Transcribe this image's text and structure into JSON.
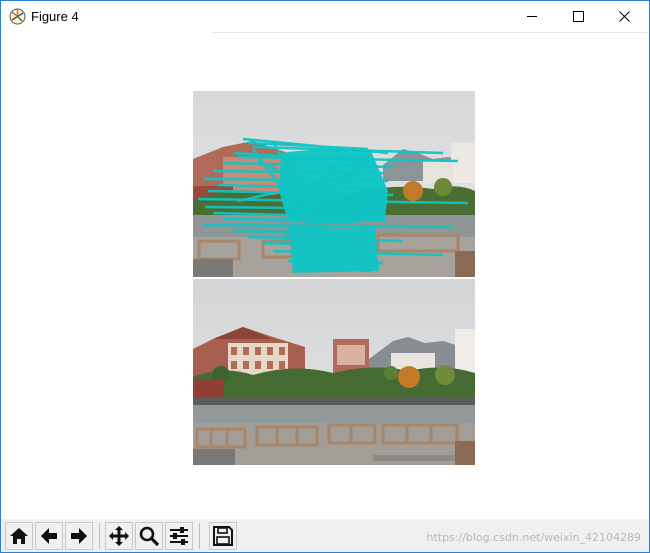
{
  "window": {
    "title": "Figure 4"
  },
  "toolbar": {
    "buttons": [
      {
        "name": "home-button",
        "icon": "home-icon"
      },
      {
        "name": "back-button",
        "icon": "arrow-left-icon"
      },
      {
        "name": "forward-button",
        "icon": "arrow-right-icon"
      },
      {
        "name": "pan-button",
        "icon": "move-icon"
      },
      {
        "name": "zoom-button",
        "icon": "magnifier-icon"
      },
      {
        "name": "subplots-button",
        "icon": "sliders-icon"
      },
      {
        "name": "save-button",
        "icon": "floppy-disk-icon"
      }
    ]
  },
  "watermark": "https://blog.csdn.net/weixin_42104289",
  "colors": {
    "overlay": "#10c4c4",
    "window_border": "#2b7fd1",
    "toolbar_bg": "#f0f0f0"
  }
}
